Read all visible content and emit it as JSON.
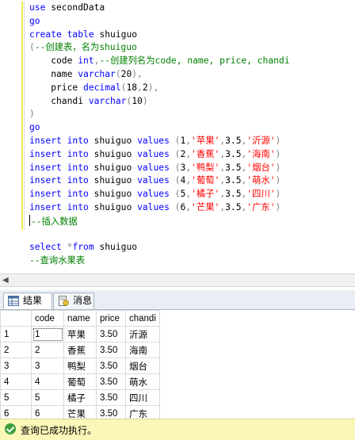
{
  "editor": {
    "lines": [
      [
        {
          "t": "use",
          "c": "kw"
        },
        {
          "t": " secondData"
        }
      ],
      [
        {
          "t": "go",
          "c": "kw"
        }
      ],
      [
        {
          "t": "create",
          "c": "kw"
        },
        {
          "t": " "
        },
        {
          "t": "table",
          "c": "kw"
        },
        {
          "t": " shuiguo"
        }
      ],
      [
        {
          "t": "(",
          "c": "op"
        },
        {
          "t": "--创建表，名为shuiguo",
          "c": "cm"
        }
      ],
      [
        {
          "t": "    code "
        },
        {
          "t": "int",
          "c": "kw"
        },
        {
          "t": ",",
          "c": "op"
        },
        {
          "t": "--创建列名为code, name, price, chandi",
          "c": "cm"
        }
      ],
      [
        {
          "t": "    name "
        },
        {
          "t": "varchar",
          "c": "kw"
        },
        {
          "t": "(",
          "c": "op"
        },
        {
          "t": "20"
        },
        {
          "t": "),",
          "c": "op"
        }
      ],
      [
        {
          "t": "    price "
        },
        {
          "t": "decimal",
          "c": "kw"
        },
        {
          "t": "(",
          "c": "op"
        },
        {
          "t": "18"
        },
        {
          "t": ",",
          "c": "op"
        },
        {
          "t": "2"
        },
        {
          "t": "),",
          "c": "op"
        }
      ],
      [
        {
          "t": "    chandi "
        },
        {
          "t": "varchar",
          "c": "kw"
        },
        {
          "t": "(",
          "c": "op"
        },
        {
          "t": "10"
        },
        {
          "t": ")",
          "c": "op"
        }
      ],
      [
        {
          "t": ")",
          "c": "op"
        }
      ],
      [
        {
          "t": "go",
          "c": "kw"
        }
      ],
      [
        {
          "t": "insert",
          "c": "kw"
        },
        {
          "t": " "
        },
        {
          "t": "into",
          "c": "kw"
        },
        {
          "t": " shuiguo "
        },
        {
          "t": "values",
          "c": "kw"
        },
        {
          "t": " (",
          "c": "op"
        },
        {
          "t": "1"
        },
        {
          "t": ",",
          "c": "op"
        },
        {
          "t": "'苹果'",
          "c": "str"
        },
        {
          "t": ",",
          "c": "op"
        },
        {
          "t": "3.5"
        },
        {
          "t": ",",
          "c": "op"
        },
        {
          "t": "'沂源'",
          "c": "str"
        },
        {
          "t": ")",
          "c": "op"
        }
      ],
      [
        {
          "t": "insert",
          "c": "kw"
        },
        {
          "t": " "
        },
        {
          "t": "into",
          "c": "kw"
        },
        {
          "t": " shuiguo "
        },
        {
          "t": "values",
          "c": "kw"
        },
        {
          "t": " (",
          "c": "op"
        },
        {
          "t": "2"
        },
        {
          "t": ",",
          "c": "op"
        },
        {
          "t": "'香蕉'",
          "c": "str"
        },
        {
          "t": ",",
          "c": "op"
        },
        {
          "t": "3.5"
        },
        {
          "t": ",",
          "c": "op"
        },
        {
          "t": "'海南'",
          "c": "str"
        },
        {
          "t": ")",
          "c": "op"
        }
      ],
      [
        {
          "t": "insert",
          "c": "kw"
        },
        {
          "t": " "
        },
        {
          "t": "into",
          "c": "kw"
        },
        {
          "t": " shuiguo "
        },
        {
          "t": "values",
          "c": "kw"
        },
        {
          "t": " (",
          "c": "op"
        },
        {
          "t": "3"
        },
        {
          "t": ",",
          "c": "op"
        },
        {
          "t": "'鸭梨'",
          "c": "str"
        },
        {
          "t": ",",
          "c": "op"
        },
        {
          "t": "3.5"
        },
        {
          "t": ",",
          "c": "op"
        },
        {
          "t": "'烟台'",
          "c": "str"
        },
        {
          "t": ")",
          "c": "op"
        }
      ],
      [
        {
          "t": "insert",
          "c": "kw"
        },
        {
          "t": " "
        },
        {
          "t": "into",
          "c": "kw"
        },
        {
          "t": " shuiguo "
        },
        {
          "t": "values",
          "c": "kw"
        },
        {
          "t": " (",
          "c": "op"
        },
        {
          "t": "4"
        },
        {
          "t": ",",
          "c": "op"
        },
        {
          "t": "'葡萄'",
          "c": "str"
        },
        {
          "t": ",",
          "c": "op"
        },
        {
          "t": "3.5"
        },
        {
          "t": ",",
          "c": "op"
        },
        {
          "t": "'萌水'",
          "c": "str"
        },
        {
          "t": ")",
          "c": "op"
        }
      ],
      [
        {
          "t": "insert",
          "c": "kw"
        },
        {
          "t": " "
        },
        {
          "t": "into",
          "c": "kw"
        },
        {
          "t": " shuiguo "
        },
        {
          "t": "values",
          "c": "kw"
        },
        {
          "t": " (",
          "c": "op"
        },
        {
          "t": "5"
        },
        {
          "t": ",",
          "c": "op"
        },
        {
          "t": "'橘子'",
          "c": "str"
        },
        {
          "t": ",",
          "c": "op"
        },
        {
          "t": "3.5"
        },
        {
          "t": ",",
          "c": "op"
        },
        {
          "t": "'四川'",
          "c": "str"
        },
        {
          "t": ")",
          "c": "op"
        }
      ],
      [
        {
          "t": "insert",
          "c": "kw"
        },
        {
          "t": " "
        },
        {
          "t": "into",
          "c": "kw"
        },
        {
          "t": " shuiguo "
        },
        {
          "t": "values",
          "c": "kw"
        },
        {
          "t": " (",
          "c": "op"
        },
        {
          "t": "6"
        },
        {
          "t": ",",
          "c": "op"
        },
        {
          "t": "'芒果'",
          "c": "str"
        },
        {
          "t": ",",
          "c": "op"
        },
        {
          "t": "3.5"
        },
        {
          "t": ",",
          "c": "op"
        },
        {
          "t": "'广东'",
          "c": "str"
        },
        {
          "t": ")",
          "c": "op"
        }
      ],
      [
        {
          "t": "--插入数据",
          "c": "cm",
          "caret": true
        }
      ],
      [],
      [
        {
          "t": "select",
          "c": "kw"
        },
        {
          "t": " "
        },
        {
          "t": "*",
          "c": "op"
        },
        {
          "t": "from",
          "c": "kw"
        },
        {
          "t": " shuiguo"
        }
      ],
      [
        {
          "t": "--查询水果表",
          "c": "cm"
        }
      ]
    ]
  },
  "tabs": {
    "results_label": "结果",
    "messages_label": "消息"
  },
  "grid": {
    "columns": [
      "code",
      "name",
      "price",
      "chandi"
    ],
    "rows": [
      [
        "1",
        "1",
        "苹果",
        "3.50",
        "沂源"
      ],
      [
        "2",
        "2",
        "香蕉",
        "3.50",
        "海南"
      ],
      [
        "3",
        "3",
        "鸭梨",
        "3.50",
        "烟台"
      ],
      [
        "4",
        "4",
        "葡萄",
        "3.50",
        "萌水"
      ],
      [
        "5",
        "5",
        "橘子",
        "3.50",
        "四川"
      ],
      [
        "6",
        "6",
        "芒果",
        "3.50",
        "广东"
      ]
    ]
  },
  "status": {
    "text": "查询已成功执行。"
  },
  "colors": {
    "keyword": "#0000ff",
    "string": "#ff0000",
    "comment": "#008000",
    "status_bg": "#fbf7b8"
  }
}
